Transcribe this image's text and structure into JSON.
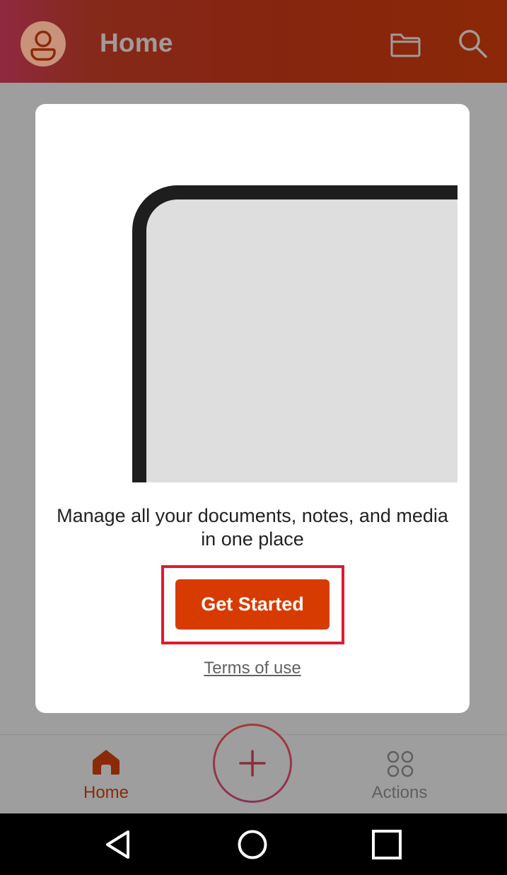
{
  "header": {
    "title": "Home",
    "avatar_icon": "person-icon",
    "folder_icon": "folder-icon",
    "search_icon": "search-icon"
  },
  "dialog": {
    "tagline": "Manage all your documents, notes, and media in one place",
    "primary_button": "Get Started",
    "terms_link": "Terms of use"
  },
  "bottom_nav": {
    "items": [
      {
        "label": "Home",
        "icon": "home-icon",
        "selected": true
      },
      {
        "label": "Actions",
        "icon": "grid-icon",
        "selected": false
      }
    ],
    "fab_icon": "plus-icon"
  },
  "system_nav": {
    "buttons": [
      "back-icon",
      "home-circle-icon",
      "recents-icon"
    ]
  },
  "colors": {
    "brand": "#d83b01",
    "appbar": "#862510",
    "nav_selected": "#8a2a07",
    "highlight": "#e01a2e"
  }
}
